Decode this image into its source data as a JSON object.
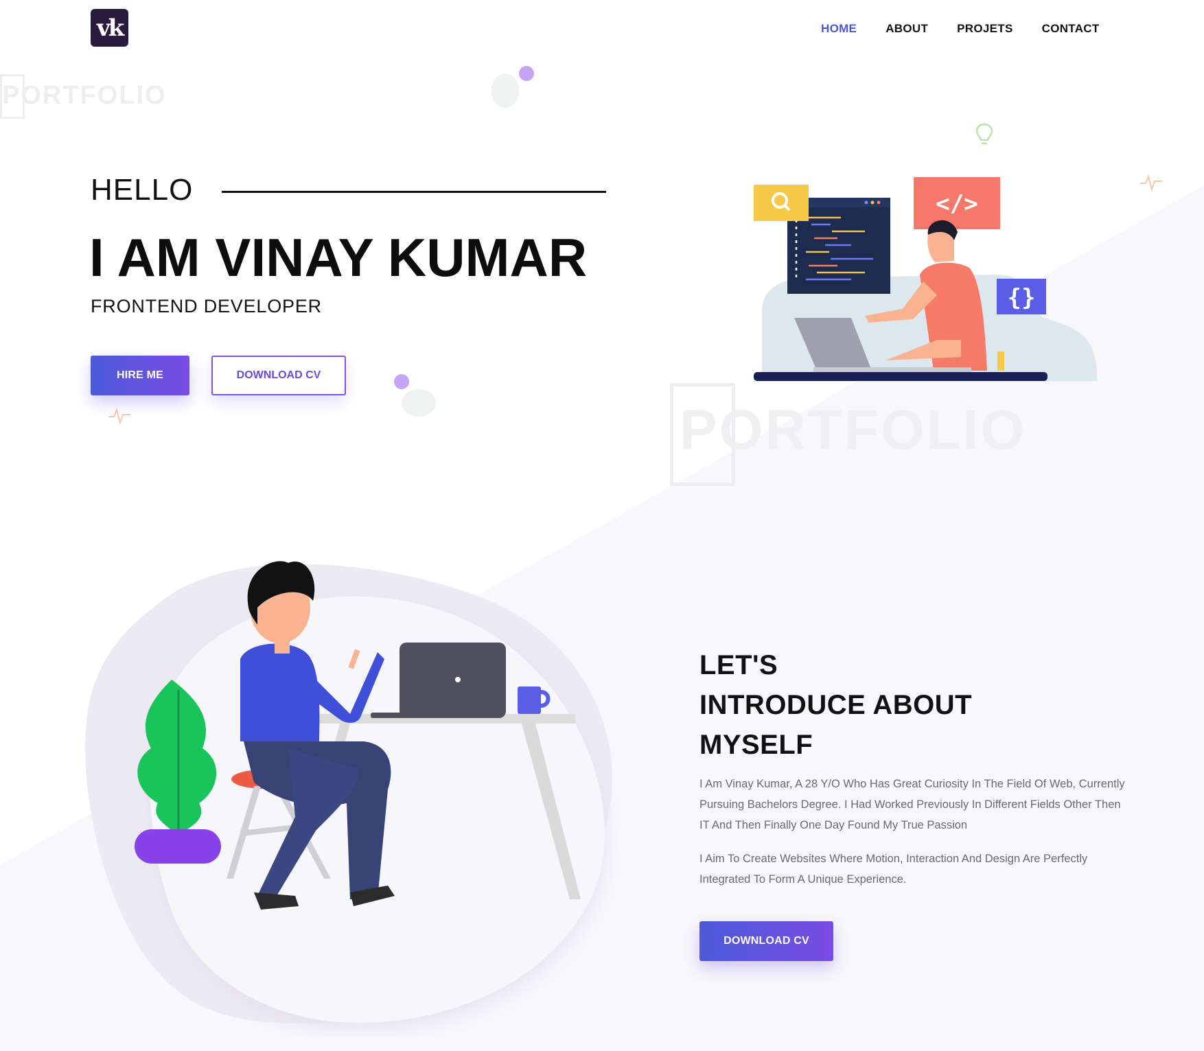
{
  "header": {
    "logo_text": "vk",
    "nav": [
      {
        "label": "HOME",
        "active": true
      },
      {
        "label": "ABOUT",
        "active": false
      },
      {
        "label": "PROJETS",
        "active": false
      },
      {
        "label": "CONTACT",
        "active": false
      }
    ]
  },
  "watermark": {
    "text": "PORTFOLIO"
  },
  "hero": {
    "greeting": "HELLO",
    "name": "I AM VINAY KUMAR",
    "role": "FRONTEND DEVELOPER",
    "hire_button": "HIRE ME",
    "download_button": "DOWNLOAD CV"
  },
  "about": {
    "title_lines": [
      "LET'S",
      "INTRODUCE ABOUT",
      "MYSELF"
    ],
    "paragraph_1": "I Am Vinay Kumar, A 28 Y/O Who Has Great Curiosity In The Field Of Web, Currently Pursuing Bachelors Degree. I Had Worked Previously In Different Fields Other Then IT And Then Finally One Day Found My True Passion",
    "paragraph_2": "I Aim To Create Websites Where Motion, Interaction And Design Are Perfectly Integrated To Form A Unique Experience.",
    "download_button": "DOWNLOAD CV"
  },
  "colors": {
    "accent": "#4c57d6",
    "accent_purple": "#7a4be6",
    "logo_bg": "#2a1a3d",
    "text_dark": "#111111",
    "text_muted": "#6a6a6a"
  },
  "icons": [
    "search-icon",
    "code-tag-icon",
    "curly-braces-icon",
    "lightbulb-icon",
    "pulse-icon"
  ]
}
